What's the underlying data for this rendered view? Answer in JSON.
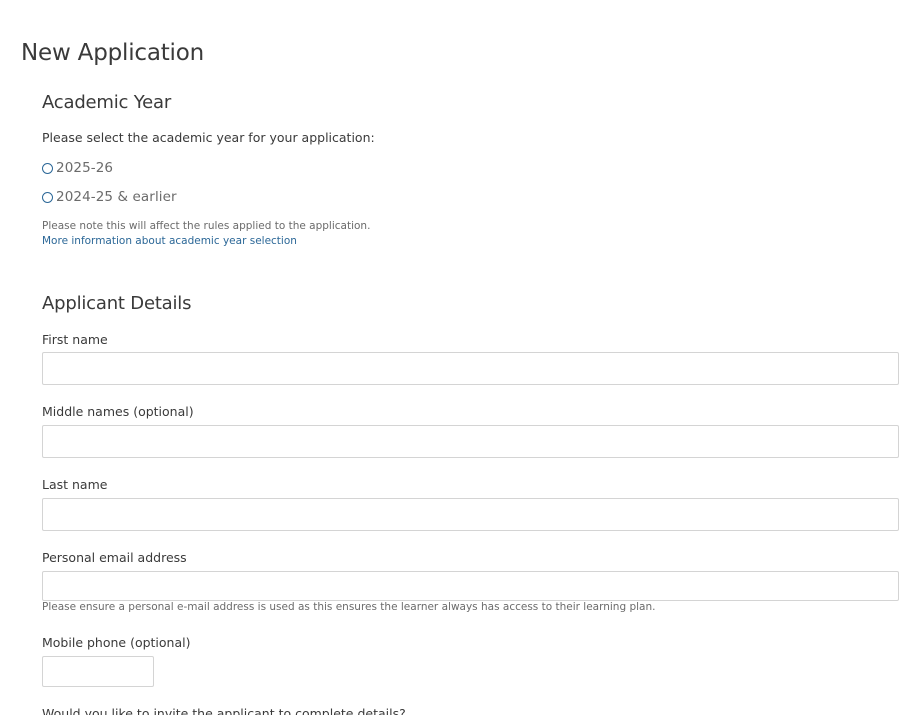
{
  "page": {
    "title": "New Application"
  },
  "academic_year": {
    "heading": "Academic Year",
    "prompt": "Please select the academic year for your application:",
    "options": [
      {
        "label": "2025-26",
        "selected": false
      },
      {
        "label": "2024-25 & earlier",
        "selected": false
      }
    ],
    "note": "Please note this will affect the rules applied to the application.",
    "info_link": "More information about academic year selection"
  },
  "applicant": {
    "heading": "Applicant Details",
    "first_name": {
      "label": "First name",
      "value": "",
      "placeholder": ""
    },
    "middle_names": {
      "label": "Middle names (optional)",
      "value": "",
      "placeholder": ""
    },
    "last_name": {
      "label": "Last name",
      "value": "",
      "placeholder": ""
    },
    "email": {
      "label": "Personal email address",
      "value": "",
      "placeholder": "",
      "help": "Please ensure a personal e-mail address is used as this ensures the learner always has access to their learning plan."
    },
    "mobile": {
      "label": "Mobile phone (optional)",
      "value": "",
      "placeholder": ""
    },
    "invite_question": "Would you like to invite the applicant to complete details?"
  },
  "colors": {
    "text": "#3a3a3a",
    "muted": "#6b6b6b",
    "accent": "#2b6797",
    "border": "#d4d4d4"
  }
}
